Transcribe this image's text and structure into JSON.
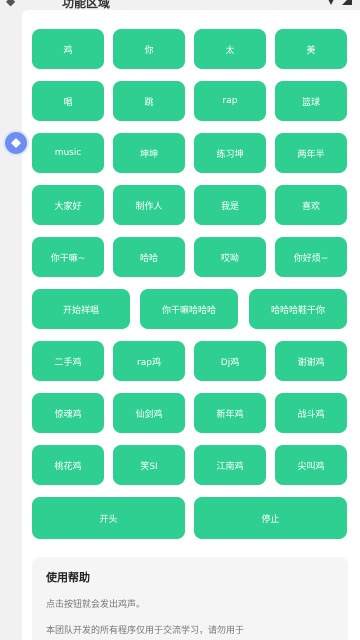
{
  "status_bar": {
    "title": "功能区域"
  },
  "rows": [
    [
      "鸡",
      "你",
      "太",
      "美"
    ],
    [
      "唱",
      "跳",
      "rap",
      "篮球"
    ],
    [
      "music",
      "坤坤",
      "练习坤",
      "两年半"
    ],
    [
      "大家好",
      "制作人",
      "我是",
      "喜欢"
    ],
    [
      "你干嘛~",
      "哈哈",
      "哎呦",
      "你好烦~"
    ],
    [
      "开始祥唱",
      "你干嘛哈哈哈",
      "哈哈哈鞋干你"
    ],
    [
      "二手鸡",
      "rap鸡",
      "Dj鸡",
      "谢谢鸡"
    ],
    [
      "惊魂鸡",
      "仙剑鸡",
      "新年鸡",
      "战斗鸡"
    ],
    [
      "桃花鸡",
      "笑SI",
      "江南鸡",
      "尖叫鸡"
    ],
    [
      "开头",
      "停止"
    ]
  ],
  "help": {
    "title": "使用帮助",
    "line1": "点击按钮就会发出鸡声。",
    "line2": "本团队开发的所有程序仅用于交流学习，请勿用于"
  },
  "colors": {
    "button": "#2fcf92",
    "card": "#ffffff",
    "background": "#f1f1f1",
    "side_button": "#6d8ef0"
  }
}
